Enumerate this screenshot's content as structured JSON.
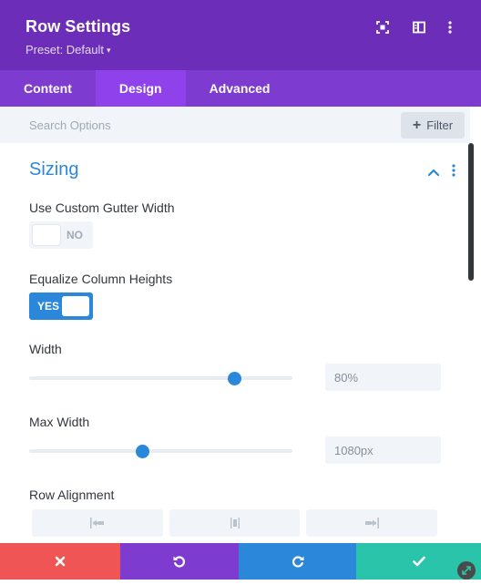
{
  "header": {
    "title": "Row Settings",
    "preset": "Preset: Default",
    "preset_caret": "▾",
    "icons": [
      "expand-icon",
      "sidebar-toggle-icon",
      "more-vertical-icon"
    ]
  },
  "tabs": [
    {
      "label": "Content",
      "active": false
    },
    {
      "label": "Design",
      "active": true
    },
    {
      "label": "Advanced",
      "active": false
    }
  ],
  "search": {
    "placeholder": "Search Options",
    "filter_label": "Filter",
    "filter_icon": "plus-icon"
  },
  "section": {
    "title": "Sizing",
    "icons": [
      "chevron-up-icon",
      "more-vertical-icon"
    ]
  },
  "fields": {
    "custom_gutter": {
      "label": "Use Custom Gutter Width",
      "state": "NO"
    },
    "equalize_heights": {
      "label": "Equalize Column Heights",
      "state": "YES"
    },
    "width": {
      "label": "Width",
      "value": "80%",
      "slider_fraction": 0.78
    },
    "max_width": {
      "label": "Max Width",
      "value": "1080px",
      "slider_fraction": 0.43
    },
    "row_alignment": {
      "label": "Row Alignment",
      "options": [
        "align-left-icon",
        "align-center-icon",
        "align-right-icon"
      ]
    }
  },
  "bottom_bar": {
    "buttons": [
      "close-icon",
      "undo-icon",
      "redo-icon",
      "checkmark-icon"
    ]
  },
  "colors": {
    "header": "#6c2eb9",
    "tabs": "#7e3bd0",
    "tab_active": "#8f42ec",
    "accent_blue": "#2b87da",
    "discard": "#ef5555",
    "undo": "#7e3bd0",
    "redo": "#2b87da",
    "save": "#29c4a9"
  }
}
